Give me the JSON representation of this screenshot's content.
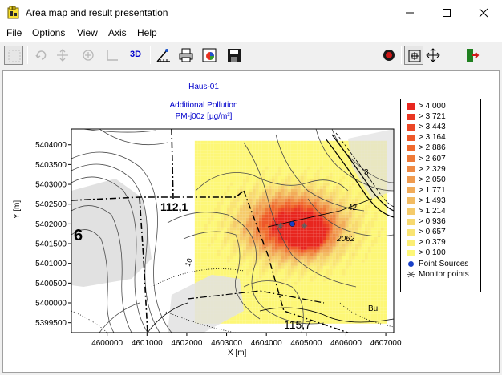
{
  "window": {
    "title": "Area map and result presentation"
  },
  "menu": [
    "File",
    "Options",
    "View",
    "Axis",
    "Help"
  ],
  "toolbar": {
    "label_3d": "3D"
  },
  "plot": {
    "title_line1": "Haus-01",
    "title_line2": "Additional Pollution",
    "title_line3": "PM-j00z [µg/m³]",
    "xlabel": "X [m]",
    "ylabel": "Y [m]",
    "map_labels": [
      "112,1",
      "6",
      "10",
      "42",
      "2062",
      "115,7",
      "3",
      "Bu"
    ]
  },
  "chart_data": {
    "type": "heatmap",
    "title": "Additional Pollution",
    "subtitle": "PM-j00z [µg/m³]",
    "xlabel": "X [m]",
    "ylabel": "Y [m]",
    "x_ticks": [
      4600000,
      4601000,
      4602000,
      4603000,
      4604000,
      4605000,
      4606000,
      4607000
    ],
    "y_ticks": [
      5399500,
      5400000,
      5400500,
      5401000,
      5401500,
      5402000,
      5402500,
      5403000,
      5403500,
      5404000
    ],
    "xlim": [
      4599100,
      4607200
    ],
    "ylim": [
      5399250,
      5404400
    ],
    "grid": false,
    "legend_position": "right",
    "color_scale": [
      {
        "label": "> 4.000",
        "color": "#e8261f"
      },
      {
        "label": "> 3.721",
        "color": "#ea3622"
      },
      {
        "label": "> 3.443",
        "color": "#ec4726"
      },
      {
        "label": "> 3.164",
        "color": "#ee5829"
      },
      {
        "label": "> 2.886",
        "color": "#f0692d"
      },
      {
        "label": "> 2.607",
        "color": "#ef7a38"
      },
      {
        "label": "> 2.329",
        "color": "#ef8a44"
      },
      {
        "label": "> 2.050",
        "color": "#f09b4f"
      },
      {
        "label": "> 1.771",
        "color": "#f2ac59"
      },
      {
        "label": "> 1.493",
        "color": "#f3bc62"
      },
      {
        "label": "> 1.214",
        "color": "#f5cb6a"
      },
      {
        "label": "> 0.936",
        "color": "#f7d96f"
      },
      {
        "label": "> 0.657",
        "color": "#f9e472"
      },
      {
        "label": "> 0.379",
        "color": "#fbee74"
      },
      {
        "label": "> 0.100",
        "color": "#fdf777"
      }
    ],
    "markers": [
      {
        "label": "Point Sources",
        "color": "#1840c8"
      },
      {
        "label": "Monitor points",
        "color": "#606060"
      }
    ],
    "point_sources": [
      {
        "x": 4604650,
        "y": 5402000
      }
    ],
    "monitor_points": [
      {
        "x": 4604350,
        "y": 5401950
      },
      {
        "x": 4604950,
        "y": 5401950
      }
    ]
  }
}
